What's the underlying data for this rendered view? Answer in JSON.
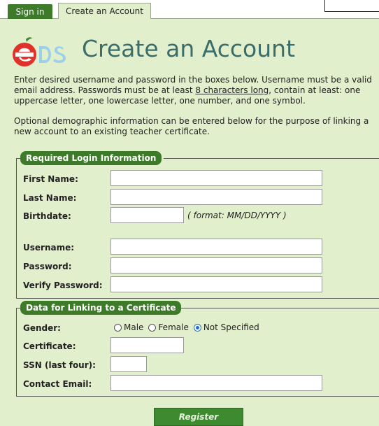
{
  "tabs": {
    "signin": "Sign in",
    "create": "Create an Account"
  },
  "logo": {
    "text": "eDS"
  },
  "page": {
    "title": "Create an Account",
    "intro_before": "Enter desired username and password in the boxes below. Username must be a valid email address. Passwords must be at least ",
    "intro_link": "8 characters long",
    "intro_after": ", contain at least: one uppercase letter, one lowercase letter, one number, and one symbol.",
    "intro2": "Optional demographic information can be entered below for the purpose of linking a new account to an existing teacher certificate."
  },
  "required": {
    "legend": "Required Login Information",
    "first_name": "First Name:",
    "last_name": "Last Name:",
    "birthdate": "Birthdate:",
    "birthdate_hint": "( format: MM/DD/YYYY )",
    "username": "Username:",
    "password": "Password:",
    "verify_password": "Verify Password:"
  },
  "linking": {
    "legend": "Data for Linking to a Certificate",
    "gender": "Gender:",
    "gender_options": [
      "Male",
      "Female",
      "Not Specified"
    ],
    "gender_selected": "Not Specified",
    "certificate": "Certificate:",
    "ssn": "SSN (last four):",
    "contact_email": "Contact Email:"
  },
  "actions": {
    "register": "Register"
  },
  "colors": {
    "background": "#e2efcd",
    "accent": "#3d7a2a",
    "title": "#3b6e6a",
    "logo_red": "#e0312b"
  }
}
